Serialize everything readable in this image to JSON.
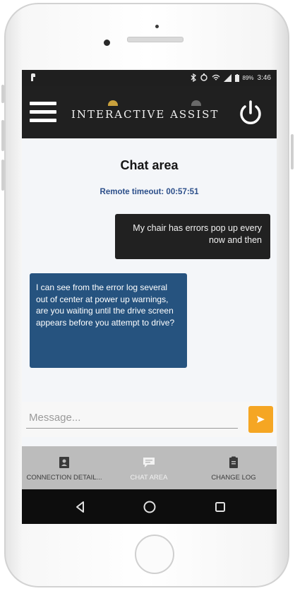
{
  "status_bar": {
    "left_icon": "notification-icon",
    "battery": "89%",
    "time": "3:46"
  },
  "app_bar": {
    "brand": "INTERACTIVE ASSIST",
    "menu_icon": "hamburger-menu-icon",
    "power_icon": "power-icon"
  },
  "chat": {
    "title": "Chat area",
    "timeout": "Remote timeout: 00:57:51",
    "messages": [
      {
        "from": "user",
        "text": "My chair has errors pop up every now and then"
      },
      {
        "from": "agent",
        "text": "I can see from the error log several out of center at power up warnings, are you waiting until the drive screen appears before you attempt to drive?"
      }
    ]
  },
  "composer": {
    "placeholder": "Message...",
    "send_icon": "send-arrow-icon"
  },
  "tabs": [
    {
      "label": "CONNECTION DETAIL...",
      "icon": "id-badge-icon",
      "active": false
    },
    {
      "label": "CHAT AREA",
      "icon": "chat-bubble-icon",
      "active": true
    },
    {
      "label": "CHANGE LOG",
      "icon": "clipboard-icon",
      "active": false
    }
  ],
  "colors": {
    "app_bar": "#202020",
    "sent_bubble": "#212121",
    "received_bubble": "#26537f",
    "send_button": "#f5a623",
    "timeout_text": "#2c4f8a",
    "tab_bar": "#bcbcbc"
  }
}
